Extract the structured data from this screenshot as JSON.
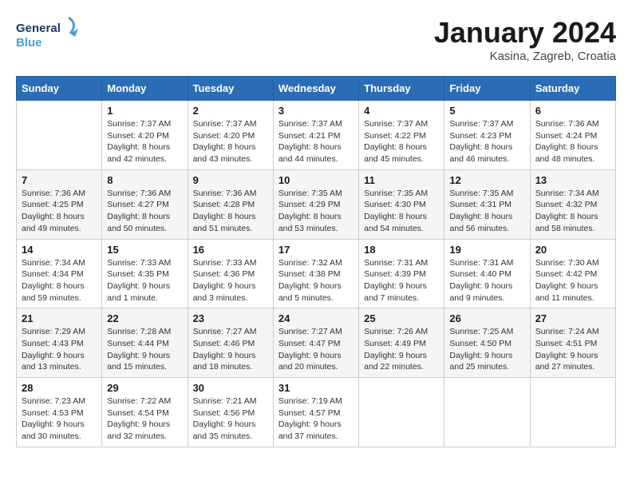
{
  "header": {
    "logo_line1": "General",
    "logo_line2": "Blue",
    "month_title": "January 2024",
    "subtitle": "Kasina, Zagreb, Croatia"
  },
  "weekdays": [
    "Sunday",
    "Monday",
    "Tuesday",
    "Wednesday",
    "Thursday",
    "Friday",
    "Saturday"
  ],
  "weeks": [
    [
      {
        "day": "",
        "info": ""
      },
      {
        "day": "1",
        "info": "Sunrise: 7:37 AM\nSunset: 4:20 PM\nDaylight: 8 hours\nand 42 minutes."
      },
      {
        "day": "2",
        "info": "Sunrise: 7:37 AM\nSunset: 4:20 PM\nDaylight: 8 hours\nand 43 minutes."
      },
      {
        "day": "3",
        "info": "Sunrise: 7:37 AM\nSunset: 4:21 PM\nDaylight: 8 hours\nand 44 minutes."
      },
      {
        "day": "4",
        "info": "Sunrise: 7:37 AM\nSunset: 4:22 PM\nDaylight: 8 hours\nand 45 minutes."
      },
      {
        "day": "5",
        "info": "Sunrise: 7:37 AM\nSunset: 4:23 PM\nDaylight: 8 hours\nand 46 minutes."
      },
      {
        "day": "6",
        "info": "Sunrise: 7:36 AM\nSunset: 4:24 PM\nDaylight: 8 hours\nand 48 minutes."
      }
    ],
    [
      {
        "day": "7",
        "info": "Sunrise: 7:36 AM\nSunset: 4:25 PM\nDaylight: 8 hours\nand 49 minutes."
      },
      {
        "day": "8",
        "info": "Sunrise: 7:36 AM\nSunset: 4:27 PM\nDaylight: 8 hours\nand 50 minutes."
      },
      {
        "day": "9",
        "info": "Sunrise: 7:36 AM\nSunset: 4:28 PM\nDaylight: 8 hours\nand 51 minutes."
      },
      {
        "day": "10",
        "info": "Sunrise: 7:35 AM\nSunset: 4:29 PM\nDaylight: 8 hours\nand 53 minutes."
      },
      {
        "day": "11",
        "info": "Sunrise: 7:35 AM\nSunset: 4:30 PM\nDaylight: 8 hours\nand 54 minutes."
      },
      {
        "day": "12",
        "info": "Sunrise: 7:35 AM\nSunset: 4:31 PM\nDaylight: 8 hours\nand 56 minutes."
      },
      {
        "day": "13",
        "info": "Sunrise: 7:34 AM\nSunset: 4:32 PM\nDaylight: 8 hours\nand 58 minutes."
      }
    ],
    [
      {
        "day": "14",
        "info": "Sunrise: 7:34 AM\nSunset: 4:34 PM\nDaylight: 8 hours\nand 59 minutes."
      },
      {
        "day": "15",
        "info": "Sunrise: 7:33 AM\nSunset: 4:35 PM\nDaylight: 9 hours\nand 1 minute."
      },
      {
        "day": "16",
        "info": "Sunrise: 7:33 AM\nSunset: 4:36 PM\nDaylight: 9 hours\nand 3 minutes."
      },
      {
        "day": "17",
        "info": "Sunrise: 7:32 AM\nSunset: 4:38 PM\nDaylight: 9 hours\nand 5 minutes."
      },
      {
        "day": "18",
        "info": "Sunrise: 7:31 AM\nSunset: 4:39 PM\nDaylight: 9 hours\nand 7 minutes."
      },
      {
        "day": "19",
        "info": "Sunrise: 7:31 AM\nSunset: 4:40 PM\nDaylight: 9 hours\nand 9 minutes."
      },
      {
        "day": "20",
        "info": "Sunrise: 7:30 AM\nSunset: 4:42 PM\nDaylight: 9 hours\nand 11 minutes."
      }
    ],
    [
      {
        "day": "21",
        "info": "Sunrise: 7:29 AM\nSunset: 4:43 PM\nDaylight: 9 hours\nand 13 minutes."
      },
      {
        "day": "22",
        "info": "Sunrise: 7:28 AM\nSunset: 4:44 PM\nDaylight: 9 hours\nand 15 minutes."
      },
      {
        "day": "23",
        "info": "Sunrise: 7:27 AM\nSunset: 4:46 PM\nDaylight: 9 hours\nand 18 minutes."
      },
      {
        "day": "24",
        "info": "Sunrise: 7:27 AM\nSunset: 4:47 PM\nDaylight: 9 hours\nand 20 minutes."
      },
      {
        "day": "25",
        "info": "Sunrise: 7:26 AM\nSunset: 4:49 PM\nDaylight: 9 hours\nand 22 minutes."
      },
      {
        "day": "26",
        "info": "Sunrise: 7:25 AM\nSunset: 4:50 PM\nDaylight: 9 hours\nand 25 minutes."
      },
      {
        "day": "27",
        "info": "Sunrise: 7:24 AM\nSunset: 4:51 PM\nDaylight: 9 hours\nand 27 minutes."
      }
    ],
    [
      {
        "day": "28",
        "info": "Sunrise: 7:23 AM\nSunset: 4:53 PM\nDaylight: 9 hours\nand 30 minutes."
      },
      {
        "day": "29",
        "info": "Sunrise: 7:22 AM\nSunset: 4:54 PM\nDaylight: 9 hours\nand 32 minutes."
      },
      {
        "day": "30",
        "info": "Sunrise: 7:21 AM\nSunset: 4:56 PM\nDaylight: 9 hours\nand 35 minutes."
      },
      {
        "day": "31",
        "info": "Sunrise: 7:19 AM\nSunset: 4:57 PM\nDaylight: 9 hours\nand 37 minutes."
      },
      {
        "day": "",
        "info": ""
      },
      {
        "day": "",
        "info": ""
      },
      {
        "day": "",
        "info": ""
      }
    ]
  ]
}
